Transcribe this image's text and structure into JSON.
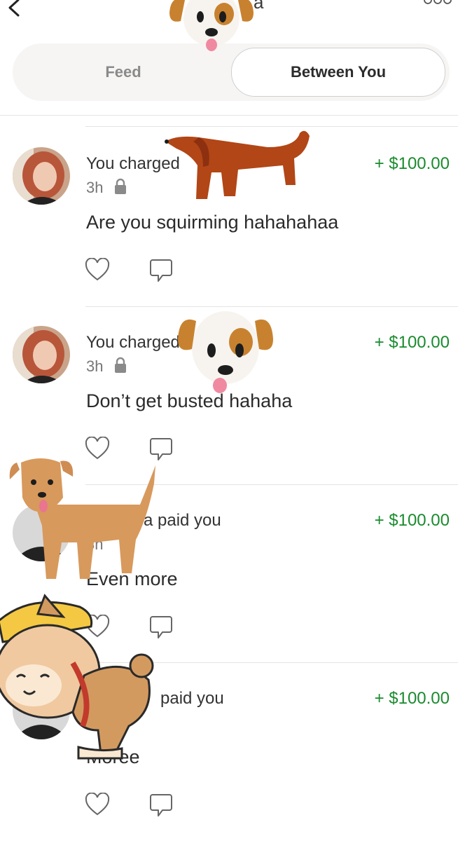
{
  "header": {
    "title_fragment": "a"
  },
  "tabs": {
    "feed": "Feed",
    "between": "Between You"
  },
  "items": [
    {
      "action": "You charged",
      "amount": "+ $100.00",
      "time": "3h",
      "note": "Are you squirming hahahahaa"
    },
    {
      "action": "You charged",
      "amount": "+ $100.00",
      "time": "3h",
      "note": "Don’t get busted hahaha"
    },
    {
      "action": "a paid you",
      "amount": "+ $100.00",
      "time": "3h",
      "note": "Even more"
    },
    {
      "action": "paid you",
      "amount": "+ $100.00",
      "time": "",
      "note": "Moree"
    }
  ],
  "colors": {
    "amount": "#1a8b2e",
    "accent": "#2b2b2b"
  },
  "icons": [
    "back-arrow-icon",
    "more-icon",
    "lock-icon",
    "heart-icon",
    "comment-icon"
  ]
}
